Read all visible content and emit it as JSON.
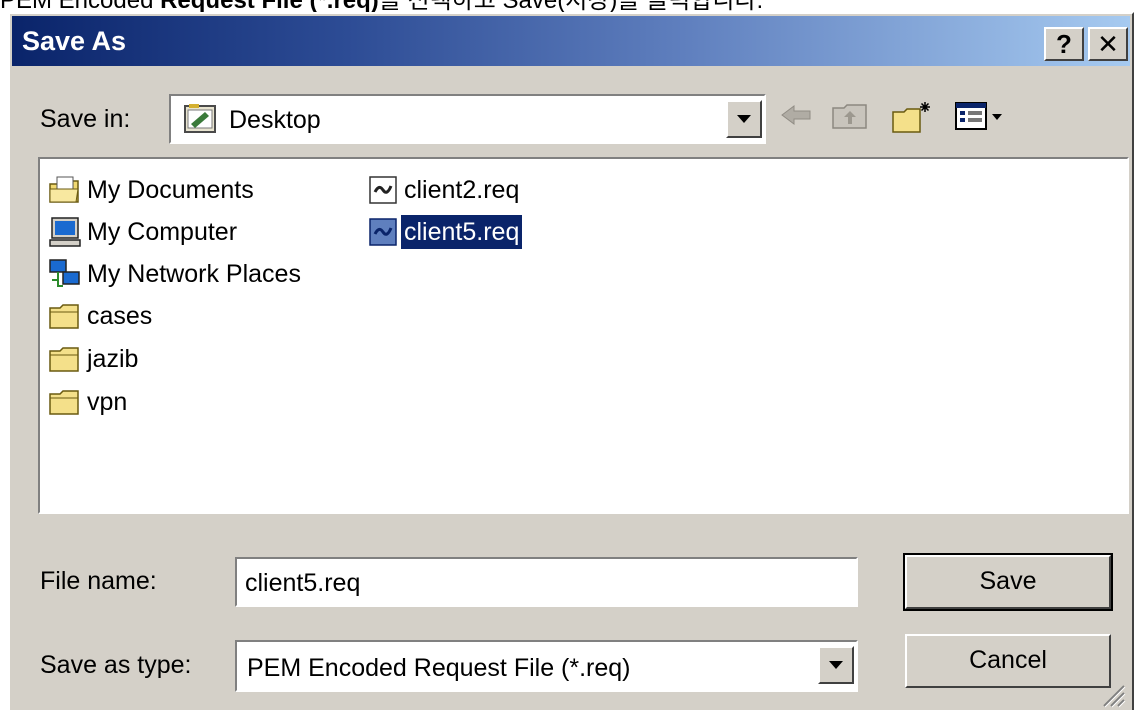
{
  "caption": {
    "prefix": "PEM Encoded ",
    "bold": "Request File (*.req)",
    "suffix": "를 선택하고 Save(저장)를 클릭합니다."
  },
  "window": {
    "title": "Save As",
    "help_button": "?",
    "close_button": "✕"
  },
  "save_in": {
    "label": "Save in:",
    "value": "Desktop",
    "icon": "desktop-icon"
  },
  "toolbar": {
    "icons": [
      "back-arrow-icon",
      "up-folder-icon",
      "new-folder-icon",
      "view-menu-icon"
    ]
  },
  "file_list": {
    "items": [
      {
        "label": "My Documents",
        "icon": "my-documents-icon"
      },
      {
        "label": "My Computer",
        "icon": "my-computer-icon"
      },
      {
        "label": "My Network Places",
        "icon": "network-places-icon"
      },
      {
        "label": "cases",
        "icon": "folder-icon"
      },
      {
        "label": "jazib",
        "icon": "folder-icon"
      },
      {
        "label": "vpn",
        "icon": "folder-icon"
      },
      {
        "label": "client2.req",
        "icon": "certificate-request-icon"
      },
      {
        "label": "client5.req",
        "icon": "certificate-request-icon",
        "selected": true
      }
    ]
  },
  "form": {
    "file_name_label": "File name:",
    "file_name_value": "client5.req",
    "save_as_type_label": "Save as type:",
    "save_as_type_value": "PEM Encoded Request File (*.req)"
  },
  "buttons": {
    "save": "Save",
    "cancel": "Cancel"
  },
  "colors": {
    "dialog_bg": "#d4d0c8",
    "title_start": "#0a246a",
    "title_end": "#a6caf0",
    "selection": "#0a246a"
  }
}
